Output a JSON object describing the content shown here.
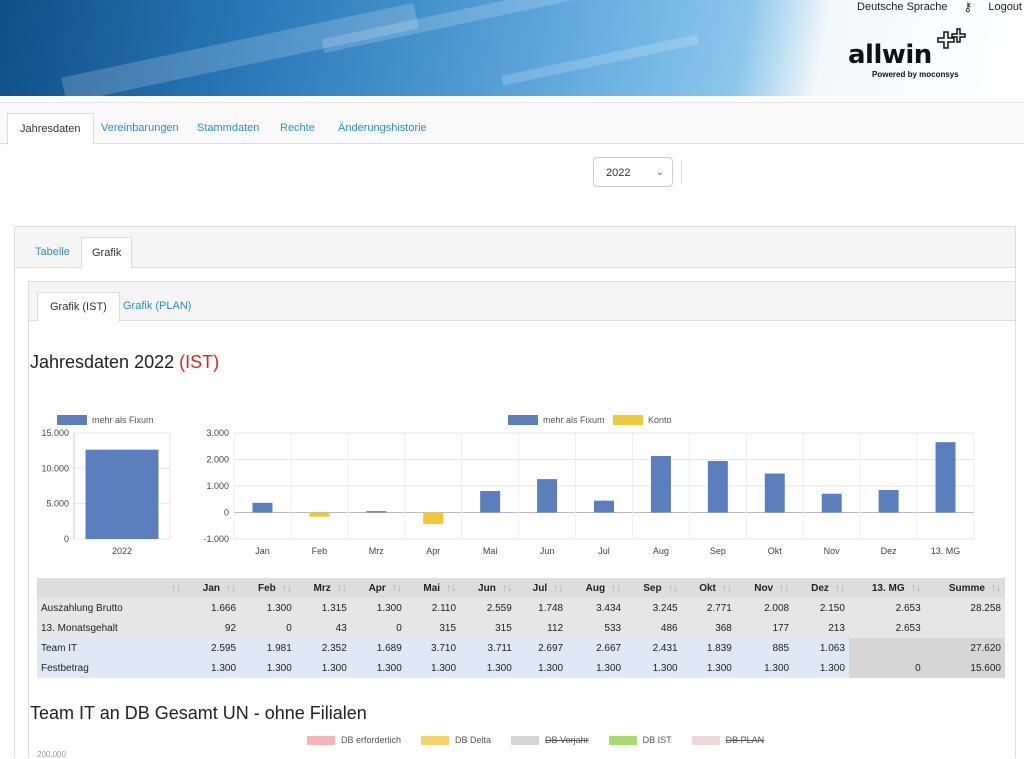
{
  "header": {
    "nav": [
      "Deutsche Sprache",
      "Logout"
    ],
    "logo_text": "allwin",
    "logo_sub": "Powered by moconsys"
  },
  "main_tabs": [
    "Jahresdaten",
    "Vereinbarungen",
    "Stammdaten",
    "Rechte",
    "Änderungshistorie"
  ],
  "year_select": "2022",
  "view_tabs": [
    "Tabelle",
    "Grafik"
  ],
  "chart_tabs": [
    "Grafik (IST)",
    "Grafik (PLAN)"
  ],
  "title_main": "Jahresdaten 2022",
  "title_suffix": "(IST)",
  "title2": "Team IT an DB Gesamt UN - ohne Filialen",
  "colors": {
    "fixum": "#5b7fbd",
    "konto": "#f0c93a",
    "link": "#2a8fc8",
    "ist_red": "#e02020"
  },
  "chart_data": [
    {
      "type": "bar",
      "categories": [
        "2022"
      ],
      "series": [
        {
          "name": "mehr als Fixum",
          "values": [
            12640
          ]
        }
      ],
      "ylim": [
        0,
        15000
      ],
      "yticks": [
        "15.000",
        "10.000",
        "5.000",
        "0"
      ],
      "legend": "top"
    },
    {
      "type": "bar",
      "categories": [
        "Jan",
        "Feb",
        "Mrz",
        "Apr",
        "Mai",
        "Jun",
        "Jul",
        "Aug",
        "Sep",
        "Okt",
        "Nov",
        "Dez",
        "13. MG"
      ],
      "series": [
        {
          "name": "mehr als Fixum",
          "values": [
            366,
            0,
            52,
            0,
            810,
            1259,
            448,
            2134,
            1945,
            1471,
            708,
            850,
            2653
          ]
        },
        {
          "name": "Konto",
          "values": [
            0,
            -160,
            0,
            -440,
            0,
            0,
            0,
            0,
            0,
            0,
            0,
            0,
            0
          ]
        }
      ],
      "ylim": [
        -1000,
        3000
      ],
      "yticks": [
        "3.000",
        "2.000",
        "1.000",
        "0",
        "-1.000"
      ],
      "legend": "top"
    },
    {
      "type": "table",
      "columns": [
        "",
        "Jan",
        "Feb",
        "Mrz",
        "Apr",
        "Mai",
        "Jun",
        "Jul",
        "Aug",
        "Sep",
        "Okt",
        "Nov",
        "Dez",
        "13. MG",
        "Summe"
      ],
      "rows": [
        {
          "label": "Auszahlung Brutto",
          "values": [
            "1.666",
            "1.300",
            "1.315",
            "1.300",
            "2.110",
            "2.559",
            "1.748",
            "3.434",
            "3.245",
            "2.771",
            "2.008",
            "2.150",
            "2.653",
            "28.258"
          ]
        },
        {
          "label": "13. Monatsgehalt",
          "values": [
            "92",
            "0",
            "43",
            "0",
            "315",
            "315",
            "112",
            "533",
            "486",
            "368",
            "177",
            "213",
            "2.653",
            ""
          ]
        },
        {
          "label": "Team IT",
          "values": [
            "2.595",
            "1.981",
            "2.352",
            "1.689",
            "3.710",
            "3.711",
            "2.697",
            "2.667",
            "2.431",
            "1.839",
            "885",
            "1.063",
            "",
            "27.620"
          ]
        },
        {
          "label": "Festbetrag",
          "values": [
            "1.300",
            "1.300",
            "1.300",
            "1.300",
            "1.300",
            "1.300",
            "1.300",
            "1.300",
            "1.300",
            "1.300",
            "1.300",
            "1.300",
            "0",
            "15.600"
          ]
        }
      ]
    }
  ],
  "legend2": [
    {
      "name": "DB erforderlich",
      "color": "#f6b3b8",
      "struck": false
    },
    {
      "name": "DB Delta",
      "color": "#f6d36a",
      "struck": false
    },
    {
      "name": "DB Vorjahr",
      "color": "#d4d4d4",
      "struck": true
    },
    {
      "name": "DB IST",
      "color": "#a5dc6e",
      "struck": false
    },
    {
      "name": "DB PLAN",
      "color": "#f0d6d8",
      "struck": true
    }
  ],
  "chart2_first_tick": "200.000"
}
